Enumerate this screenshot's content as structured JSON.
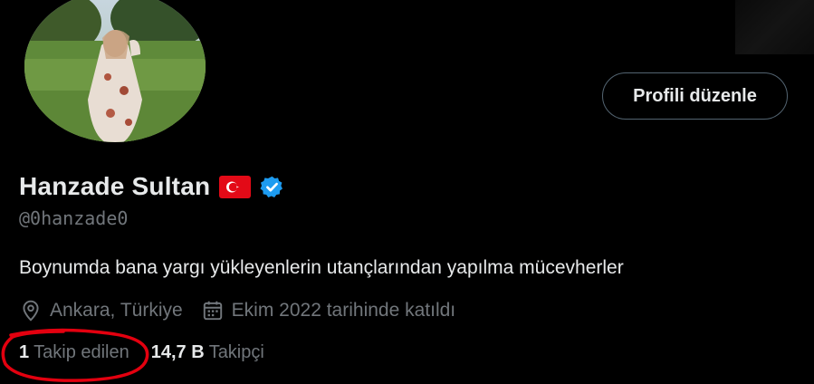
{
  "profile": {
    "name": "Hanzade Sultan",
    "handle": "@0hanzade0",
    "bio": "Boynumda bana yargı yükleyenlerin utançlarından yapılma mücevherler",
    "location": "Ankara, Türkiye",
    "joined": "Ekim 2022 tarihinde katıldı",
    "flag_icon": "turkey-flag-emoji",
    "verified_color": "#1d9bf0"
  },
  "actions": {
    "edit_profile_label": "Profili düzenle"
  },
  "stats": {
    "following_count": "1",
    "following_label": "Takip edilen",
    "followers_count": "14,7 B",
    "followers_label": "Takipçi"
  },
  "annotation": {
    "color": "#e3000f"
  }
}
